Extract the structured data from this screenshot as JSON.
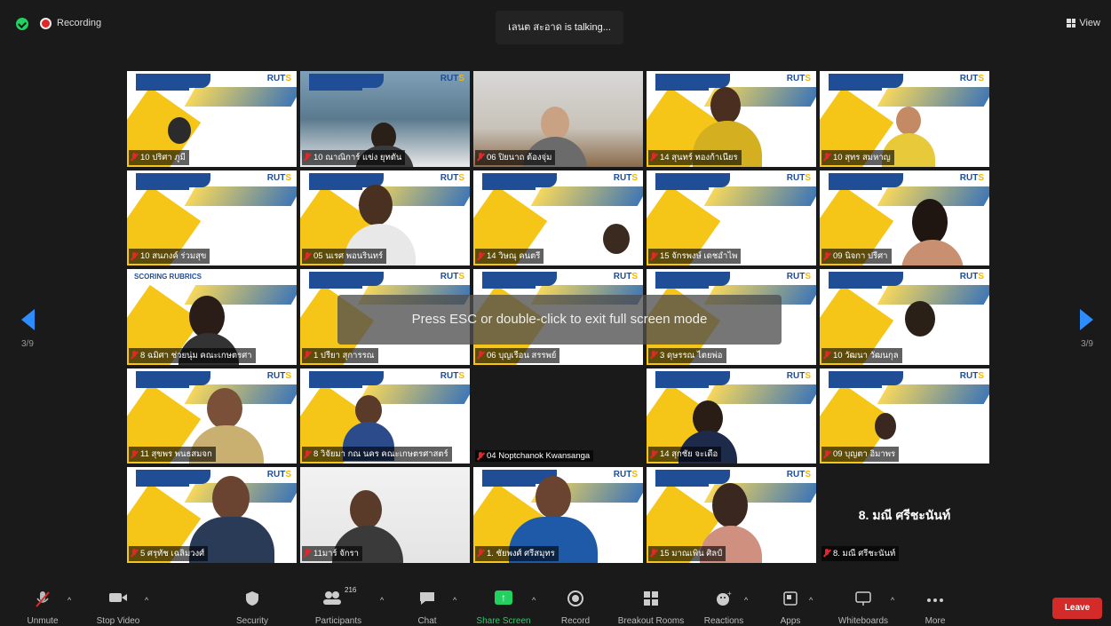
{
  "topbar": {
    "recording_label": "Recording",
    "talking_text": "เลนต สะอาด is talking...",
    "view_label": "View"
  },
  "pager": {
    "left": "3/9",
    "right": "3/9"
  },
  "overlay": {
    "text": "Press ESC or double-click to exit full screen mode"
  },
  "tiles": [
    {
      "name": "10 ปริศา ภูมี"
    },
    {
      "name": "10 ณาณิการ์ แข่ง ยุทตัน"
    },
    {
      "name": "06 ปิยนาถ ต้องจุ่ม"
    },
    {
      "name": "14 สุนทร์ ทองก้าเนียร"
    },
    {
      "name": "10 สุทร สมหาญ"
    },
    {
      "name": "10 สนภงค์ ร่วมสุข"
    },
    {
      "name": "05 นเรศ พอนรินทร์"
    },
    {
      "name": "14 วิษณุ คนตรี"
    },
    {
      "name": "15 จักรพงษ์ เดชอำไพ"
    },
    {
      "name": "09 นิจกา ปรีศา"
    },
    {
      "name": "8 ฉมิศา ช่วยนุ่ม คณะเกษตรศา"
    },
    {
      "name": "1 ปรียา สุการรณ"
    },
    {
      "name": "06 บุญเรือน สรรพย์"
    },
    {
      "name": "3 ดุษรรณ ไตยพ่อ"
    },
    {
      "name": "10 วัฒนา วัฒนกุล"
    },
    {
      "name": "11 สุขพร พนธสมจก"
    },
    {
      "name": "8 วิจัยมา กณ นคร คณะเกษตรศาสตร์"
    },
    {
      "name": "04 Noptchanok Kwansanga"
    },
    {
      "name": "14 สุกชัย จะเดือ"
    },
    {
      "name": "09 บุญตา อิมาพร"
    },
    {
      "name": "5 ศรุทัช เฉลิมวงศ์"
    },
    {
      "name": "11มาร์ จักรา"
    },
    {
      "name": "1. ชัยพงศ์ ศรีสมุทร"
    },
    {
      "name": "15 มาณเพิน ศิลป์"
    },
    {
      "name": "8. มณี ศรีชะนันท์",
      "big": "8. มณี ศรีชะนันท์"
    }
  ],
  "scoring_text": "SCORING RUBRICS",
  "logo_text": "RUT",
  "toolbar": {
    "unmute": "Unmute",
    "stop_video": "Stop Video",
    "security": "Security",
    "participants": "Participants",
    "participants_count": "216",
    "chat": "Chat",
    "share_screen": "Share Screen",
    "record": "Record",
    "breakout": "Breakout Rooms",
    "reactions": "Reactions",
    "apps": "Apps",
    "whiteboards": "Whiteboards",
    "more": "More",
    "leave": "Leave"
  },
  "colors": {
    "accent": "#2d8cff",
    "leave": "#d32a2a",
    "share": "#23d160"
  }
}
